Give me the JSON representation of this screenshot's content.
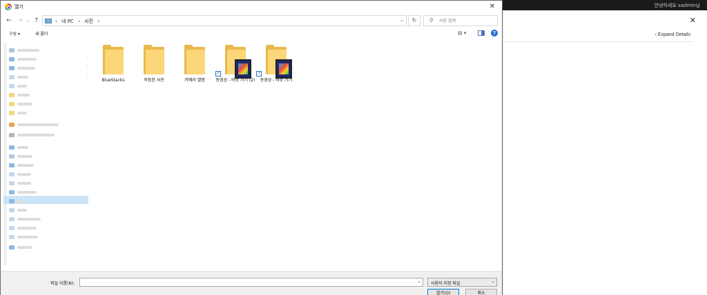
{
  "background": {
    "greeting": "안녕하세요 sadmin님",
    "close_glyph": "✕",
    "expand_details": "‹ Expand Details"
  },
  "dialog": {
    "title": "열기",
    "close_glyph": "✕",
    "address_path": [
      "내 PC",
      "사진"
    ],
    "search_placeholder": "사진 검색",
    "toolbar": {
      "organize": "구성 ▾",
      "new_folder": "새 폴더",
      "help": "?"
    },
    "items": [
      {
        "label": "BlueStacks",
        "type": "folder"
      },
      {
        "label": "저장된 사진",
        "type": "folder"
      },
      {
        "label": "카메라 앨범",
        "type": "folder"
      },
      {
        "label": "동영상 - 바로 가기 (2)",
        "type": "shortcut"
      },
      {
        "label": "동영상 - 바로 가기",
        "type": "shortcut"
      }
    ],
    "filename_label": "파일 이름(N):",
    "filename_value": "",
    "filetype_value": "사용자 지정 파일",
    "open_label": "열기(O)",
    "cancel_label": "취소"
  },
  "icons": {
    "back": "arrow-left-icon",
    "forward": "arrow-right-icon",
    "up": "arrow-up-icon",
    "refresh": "refresh-icon",
    "search": "search-icon",
    "folder": "folder-icon",
    "video_shortcut": "video-shortcut-icon"
  },
  "colors": {
    "folder": "#fbd779",
    "selection": "#cce4f7",
    "accent": "#0078d7"
  }
}
